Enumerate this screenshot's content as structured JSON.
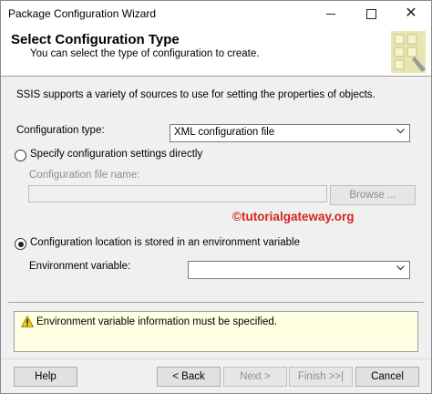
{
  "window": {
    "title": "Package Configuration Wizard"
  },
  "header": {
    "title": "Select Configuration Type",
    "subtitle": "You can select the type of configuration to create."
  },
  "description": "SSIS supports a variety of sources to use for setting the properties of objects.",
  "config_type": {
    "label": "Configuration type:",
    "value": "XML configuration file"
  },
  "option_direct": {
    "label": "Specify configuration settings directly",
    "selected": false,
    "file_name_label": "Configuration file name:",
    "file_name_value": "",
    "browse_label": "Browse ..."
  },
  "watermark": "©tutorialgateway.org",
  "option_env": {
    "label": "Configuration location is stored in an environment variable",
    "selected": true,
    "env_var_label": "Environment variable:",
    "env_var_value": ""
  },
  "warning": {
    "icon": "warning-triangle-icon",
    "text": "Environment variable information must be specified."
  },
  "buttons": {
    "help": "Help",
    "back": "< Back",
    "next": "Next >",
    "finish": "Finish >>|",
    "cancel": "Cancel"
  }
}
